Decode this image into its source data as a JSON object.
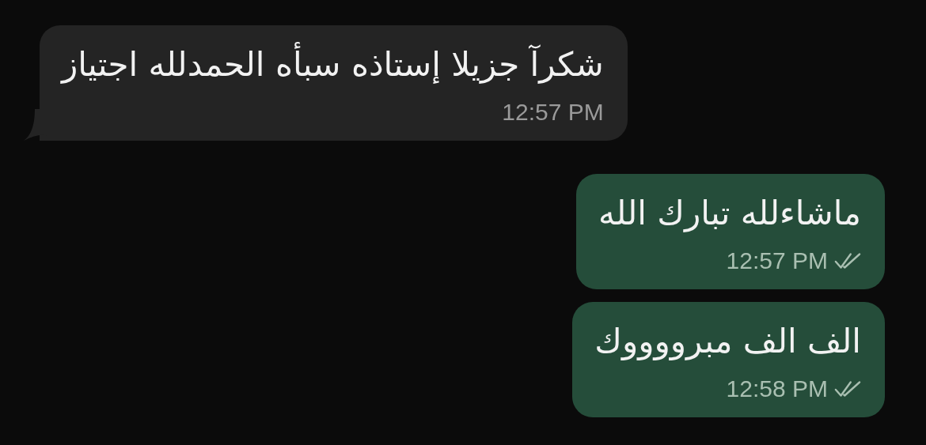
{
  "messages": [
    {
      "kind": "incoming",
      "text": "شكرآ جزيلا إستاذه سبأه الحمدلله اجتياز",
      "time": "12:57 PM"
    },
    {
      "kind": "outgoing",
      "text": "ماشاءلله تبارك الله",
      "time": "12:57 PM",
      "read": true
    },
    {
      "kind": "outgoing",
      "text": "الف الف مبرووووك",
      "time": "12:58 PM",
      "read": true
    }
  ]
}
